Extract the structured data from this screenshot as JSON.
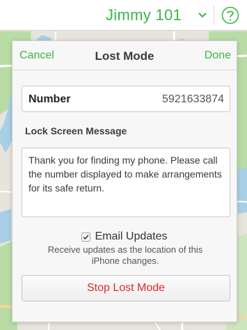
{
  "colors": {
    "accent": "#39b54a",
    "danger": "#e02b2b"
  },
  "topbar": {
    "device_name": "Jimmy 101",
    "chevron_icon": "chevron-down-icon",
    "help_icon": "question-circle-icon"
  },
  "panel": {
    "title": "Lost Mode",
    "cancel_label": "Cancel",
    "done_label": "Done",
    "number_label": "Number",
    "number_value": "5921633874",
    "message_label": "Lock Screen Message",
    "message_text": "Thank you for finding my phone. Please call the number displayed to make arrangements for its safe return.",
    "email_updates_label": "Email Updates",
    "email_updates_checked": true,
    "email_updates_description": "Receive updates as the location of this iPhone changes.",
    "stop_button_label": "Stop Lost Mode"
  }
}
